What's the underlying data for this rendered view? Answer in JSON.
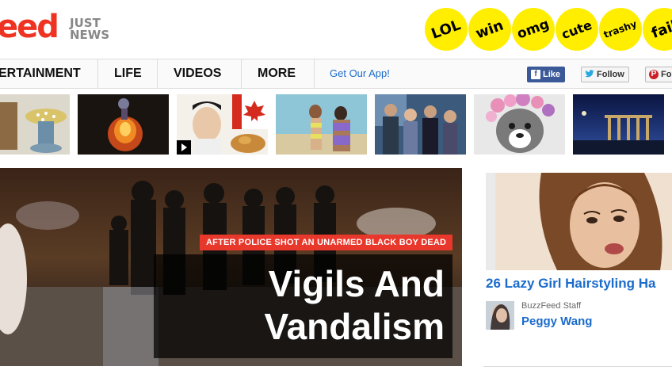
{
  "header": {
    "logo_text": "eed",
    "tagline_line1": "JUST",
    "tagline_line2": "NEWS",
    "badges": [
      {
        "label": "LOL",
        "icon": "lol-badge-icon"
      },
      {
        "label": "win",
        "icon": "win-badge-icon"
      },
      {
        "label": "omg",
        "icon": "omg-badge-icon"
      },
      {
        "label": "cute",
        "icon": "cute-badge-icon"
      },
      {
        "label": "trashy",
        "icon": "trashy-badge-icon"
      },
      {
        "label": "fail",
        "icon": "fail-badge-icon"
      }
    ]
  },
  "nav": {
    "items": [
      {
        "label": "ERTAINMENT"
      },
      {
        "label": "LIFE"
      },
      {
        "label": "VIDEOS"
      },
      {
        "label": "MORE"
      }
    ],
    "app_link": "Get Our App!",
    "social": {
      "facebook": "Like",
      "twitter": "Follow",
      "pinterest": "Fo"
    }
  },
  "thumbnails": [
    {
      "name": "spools"
    },
    {
      "name": "fire-figure"
    },
    {
      "name": "canada-guy-video"
    },
    {
      "name": "beach-women"
    },
    {
      "name": "tv-cast"
    },
    {
      "name": "flower-dog"
    },
    {
      "name": "ruins-night"
    }
  ],
  "feature": {
    "tag": "AFTER POLICE SHOT AN UNARMED BLACK BOY DEAD",
    "title_line1": "Vigils And",
    "title_line2": "Vandalism"
  },
  "sidebar": {
    "title": "26 Lazy Girl Hairstyling Ha",
    "author_role": "BuzzFeed Staff",
    "author_name": "Peggy Wang"
  },
  "colors": {
    "brand_red": "#ee3322",
    "badge_yellow": "#ffee00",
    "link_blue": "#1a6bcc"
  }
}
